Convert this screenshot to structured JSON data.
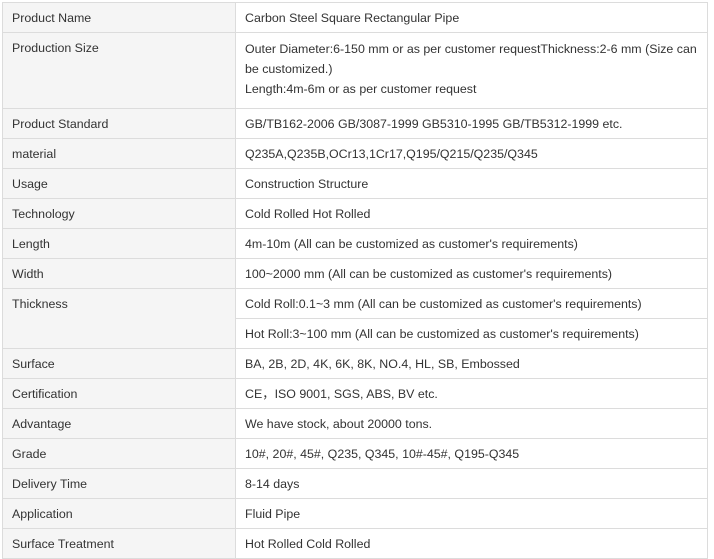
{
  "rows": [
    {
      "key": "Product Name",
      "value": "Carbon Steel Square Rectangular Pipe"
    },
    {
      "key": "Production Size",
      "value_lines": [
        "Outer Diameter:6-150 mm or as per customer requestThickness:2-6 mm (Size can be customized.)",
        "Length:4m-6m or as per customer request"
      ]
    },
    {
      "key": "Product Standard",
      "value": "GB/TB162-2006 GB/3087-1999 GB5310-1995 GB/TB5312-1999 etc."
    },
    {
      "key": "material",
      "value": "Q235A,Q235B,OCr13,1Cr17,Q195/Q215/Q235/Q345"
    },
    {
      "key": "Usage",
      "value": "Construction Structure"
    },
    {
      "key": "Technology",
      "value": "Cold Rolled Hot Rolled"
    },
    {
      "key": "Length",
      "value": "4m-10m (All can be customized as customer's requirements)"
    },
    {
      "key": "Width",
      "value": "100~2000 mm (All can be customized as customer's requirements)"
    },
    {
      "key": "Thickness",
      "values": [
        "Cold Roll:0.1~3 mm (All can be customized as customer's requirements)",
        "Hot Roll:3~100 mm (All can be customized as customer's requirements)"
      ]
    },
    {
      "key": "Surface",
      "value": "BA, 2B, 2D, 4K, 6K, 8K, NO.4, HL, SB, Embossed"
    },
    {
      "key": "Certification",
      "value": "CE，ISO 9001, SGS, ABS, BV etc."
    },
    {
      "key": "Advantage",
      "value": "We have stock, about 20000 tons."
    },
    {
      "key": "Grade",
      "value": "10#, 20#, 45#, Q235, Q345, 10#-45#, Q195-Q345"
    },
    {
      "key": "Delivery Time",
      "value": "8-14 days"
    },
    {
      "key": "Application",
      "value": "Fluid Pipe"
    },
    {
      "key": "Surface Treatment",
      "value": "Hot Rolled Cold Rolled"
    }
  ]
}
